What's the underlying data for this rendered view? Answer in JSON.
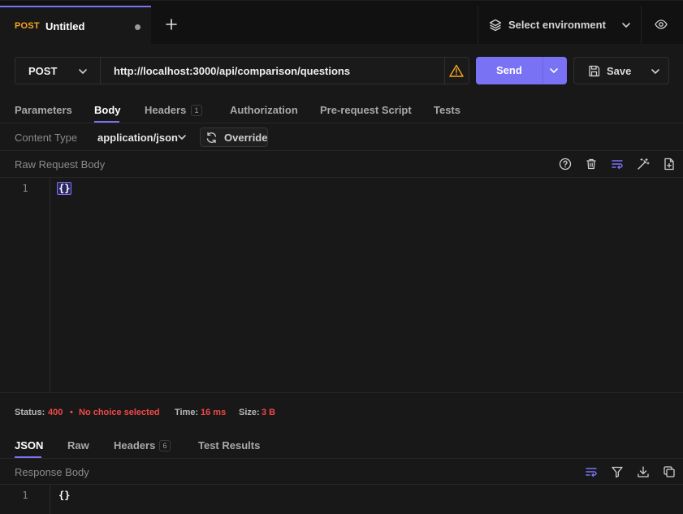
{
  "tab": {
    "method": "POST",
    "title": "Untitled"
  },
  "environment": {
    "label": "Select environment"
  },
  "request": {
    "method": "POST",
    "url": "http://localhost:3000/api/comparison/questions",
    "send_label": "Send",
    "save_label": "Save"
  },
  "request_tabs": [
    {
      "label": "Parameters"
    },
    {
      "label": "Body"
    },
    {
      "label": "Headers",
      "count": "1"
    },
    {
      "label": "Authorization"
    },
    {
      "label": "Pre-request Script"
    },
    {
      "label": "Tests"
    }
  ],
  "active_request_tab": "Body",
  "content_type": {
    "label": "Content Type",
    "value": "application/json",
    "override_label": "Override"
  },
  "raw_body": {
    "label": "Raw Request Body",
    "line_number": "1",
    "content": "{}"
  },
  "status": {
    "status_label": "Status:",
    "status_code": "400",
    "separator": "•",
    "status_text": "No choice selected",
    "time_label": "Time:",
    "time_value": "16 ms",
    "size_label": "Size:",
    "size_value": "3 B"
  },
  "response_tabs": [
    {
      "label": "JSON"
    },
    {
      "label": "Raw"
    },
    {
      "label": "Headers",
      "count": "6"
    },
    {
      "label": "Test Results"
    }
  ],
  "active_response_tab": "JSON",
  "response_body": {
    "label": "Response Body",
    "line_number": "1",
    "content": "{}"
  },
  "icons": {
    "warning": "warning-triangle-icon",
    "layers": "layers-icon",
    "eye": "eye-icon",
    "save": "floppy-disk-icon"
  },
  "colors": {
    "accent": "#7a72f5",
    "post_method": "#f5a623",
    "error": "#f04848",
    "warning": "#f5a623"
  }
}
